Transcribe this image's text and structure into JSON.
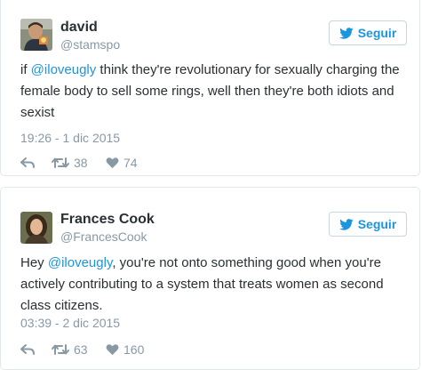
{
  "follow_label": "Seguir",
  "colors": {
    "accent": "#1b95e0",
    "muted": "#8899a6",
    "text": "#292f33",
    "border": "#e1e8ed"
  },
  "icons": {
    "follow": "twitter-bird-icon",
    "reply": "reply-icon",
    "retweet": "retweet-icon",
    "like": "heart-icon"
  },
  "tweets": [
    {
      "name": "david",
      "handle": "@stamspo",
      "text_parts": {
        "before": "if ",
        "mention": "@iloveugly",
        "after": " think they're revolutionary for sexually charging the female body to sell some rings, well then they're both idiots and sexist"
      },
      "date": "19:26 - 1 dic 2015",
      "retweets": "38",
      "likes": "74"
    },
    {
      "name": "Frances Cook",
      "handle": "@FrancesCook",
      "text_parts": {
        "before": "Hey ",
        "mention": "@iloveugly",
        "after": ", you're not onto something good when you're actively contributing to a system that treats women as second class citizens."
      },
      "date": "03:39 - 2 dic 2015",
      "retweets": "63",
      "likes": "160"
    }
  ]
}
